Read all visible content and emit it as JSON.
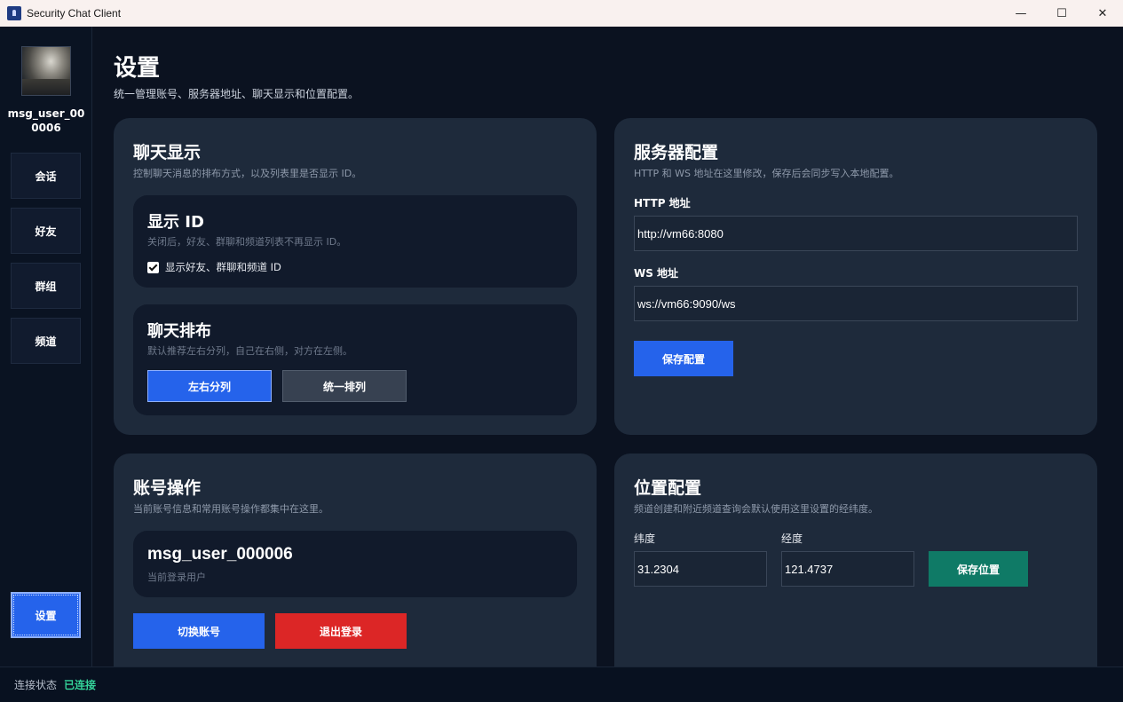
{
  "window": {
    "title": "Security Chat Client",
    "controls": {
      "minimize": "—",
      "maximize": "☐",
      "close": "✕"
    }
  },
  "sidebar": {
    "username": "msg_user_000006",
    "items": [
      {
        "label": "会话"
      },
      {
        "label": "好友"
      },
      {
        "label": "群组"
      },
      {
        "label": "频道"
      }
    ],
    "settings_label": "设置"
  },
  "page": {
    "title": "设置",
    "subtitle": "统一管理账号、服务器地址、聊天显示和位置配置。"
  },
  "chat_display": {
    "title": "聊天显示",
    "desc": "控制聊天消息的排布方式，以及列表里是否显示 ID。",
    "show_id": {
      "title": "显示 ID",
      "desc": "关闭后，好友、群聊和频道列表不再显示 ID。",
      "checkbox_label": "显示好友、群聊和频道 ID",
      "checked": true
    },
    "layout": {
      "title": "聊天排布",
      "desc": "默认推荐左右分列，自己在右侧，对方在左侧。",
      "split_label": "左右分列",
      "unified_label": "统一排列"
    }
  },
  "server": {
    "title": "服务器配置",
    "desc": "HTTP 和 WS 地址在这里修改，保存后会同步写入本地配置。",
    "http_label": "HTTP 地址",
    "http_value": "http://vm66:8080",
    "ws_label": "WS 地址",
    "ws_value": "ws://vm66:9090/ws",
    "save_label": "保存配置"
  },
  "account": {
    "title": "账号操作",
    "desc": "当前账号信息和常用账号操作都集中在这里。",
    "current_user": "msg_user_000006",
    "current_user_caption": "当前登录用户",
    "switch_label": "切换账号",
    "logout_label": "退出登录"
  },
  "location": {
    "title": "位置配置",
    "desc": "频道创建和附近频道查询会默认使用这里设置的经纬度。",
    "lat_label": "纬度",
    "lat_value": "31.2304",
    "lng_label": "经度",
    "lng_value": "121.4737",
    "save_label": "保存位置"
  },
  "status": {
    "label": "连接状态",
    "value": "已连接"
  }
}
